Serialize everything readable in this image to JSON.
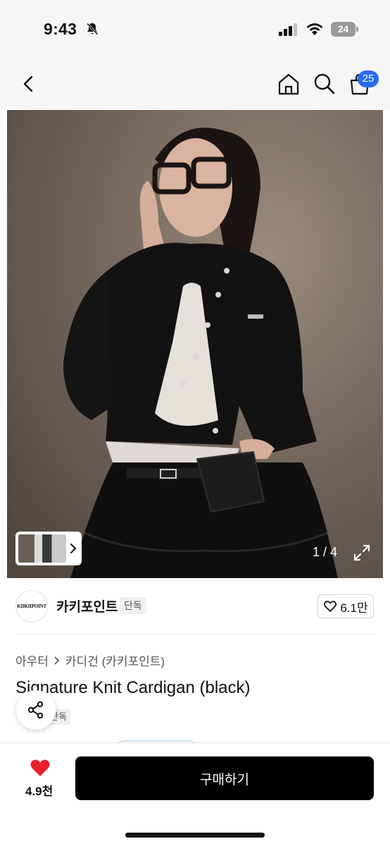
{
  "status_bar": {
    "time": "9:43",
    "battery_level": "24",
    "icons": [
      "bell-off-icon",
      "signal-icon",
      "wifi-icon",
      "battery-icon"
    ]
  },
  "nav": {
    "icons": [
      "back-icon",
      "home-icon",
      "search-icon",
      "cart-icon"
    ],
    "cart_badge": "25"
  },
  "gallery": {
    "counter": "1 / 4",
    "icons": [
      "expand-icon",
      "chevron-right-icon"
    ]
  },
  "shop": {
    "logo_text": "KIIKIIPOINT",
    "name": "카키포인트",
    "exclusive_tag": "단독",
    "likes": "6.1만"
  },
  "product": {
    "category": "아우터",
    "subcategory": "카디건 (카키포인트)",
    "title": "Signature Knit Cardigan (black)",
    "tag": "단독"
  },
  "bottom_bar": {
    "wish_count": "4.9천",
    "buy_label": "구매하기",
    "wish_color": "#e8202a"
  }
}
